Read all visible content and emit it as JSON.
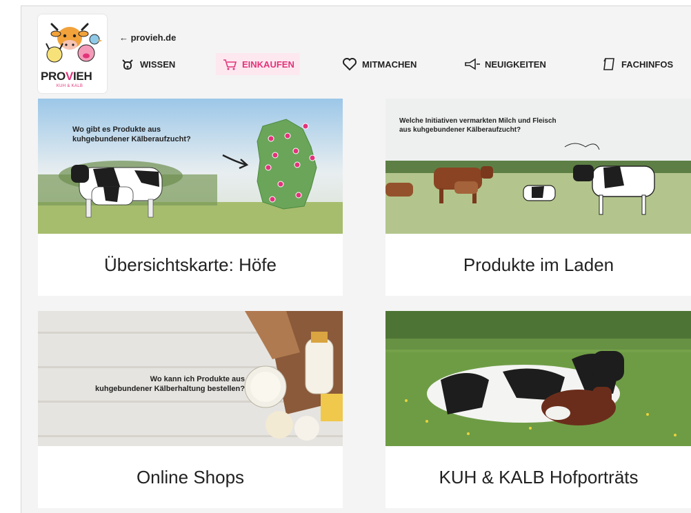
{
  "header": {
    "back_link": "← provieh.de",
    "logo": {
      "word_main": "PROVIEH",
      "subtitle": "KUH & KALB"
    },
    "nav": [
      {
        "label": "WISSEN",
        "icon": "cow-head-icon",
        "active": false
      },
      {
        "label": "EINKAUFEN",
        "icon": "shopping-cart-icon",
        "active": true
      },
      {
        "label": "MITMACHEN",
        "icon": "heart-icon",
        "active": false
      },
      {
        "label": "NEUIGKEITEN",
        "icon": "megaphone-icon",
        "active": false
      },
      {
        "label": "FACHINFOS",
        "icon": "document-icon",
        "active": false
      }
    ]
  },
  "cards": [
    {
      "title": "Übersichtskarte: Höfe",
      "overlay": [
        "Wo gibt es Produkte aus",
        "kuhgebundener Kälberaufzucht?"
      ]
    },
    {
      "title": "Produkte im Laden",
      "overlay": [
        "Welche Initiativen vermarkten Milch und Fleisch",
        "aus kuhgebundener Kälberaufzucht?"
      ]
    },
    {
      "title": "Online Shops",
      "overlay": [
        "Wo kann ich Produkte aus",
        "kuhgebundener Kälberhaltung bestellen?"
      ]
    },
    {
      "title": "KUH & KALB Hofporträts"
    }
  ],
  "colors": {
    "accent": "#e2337a",
    "active_bg": "#fde8f0",
    "page_bg": "#f4f4f4",
    "card_bg": "#ffffff"
  }
}
